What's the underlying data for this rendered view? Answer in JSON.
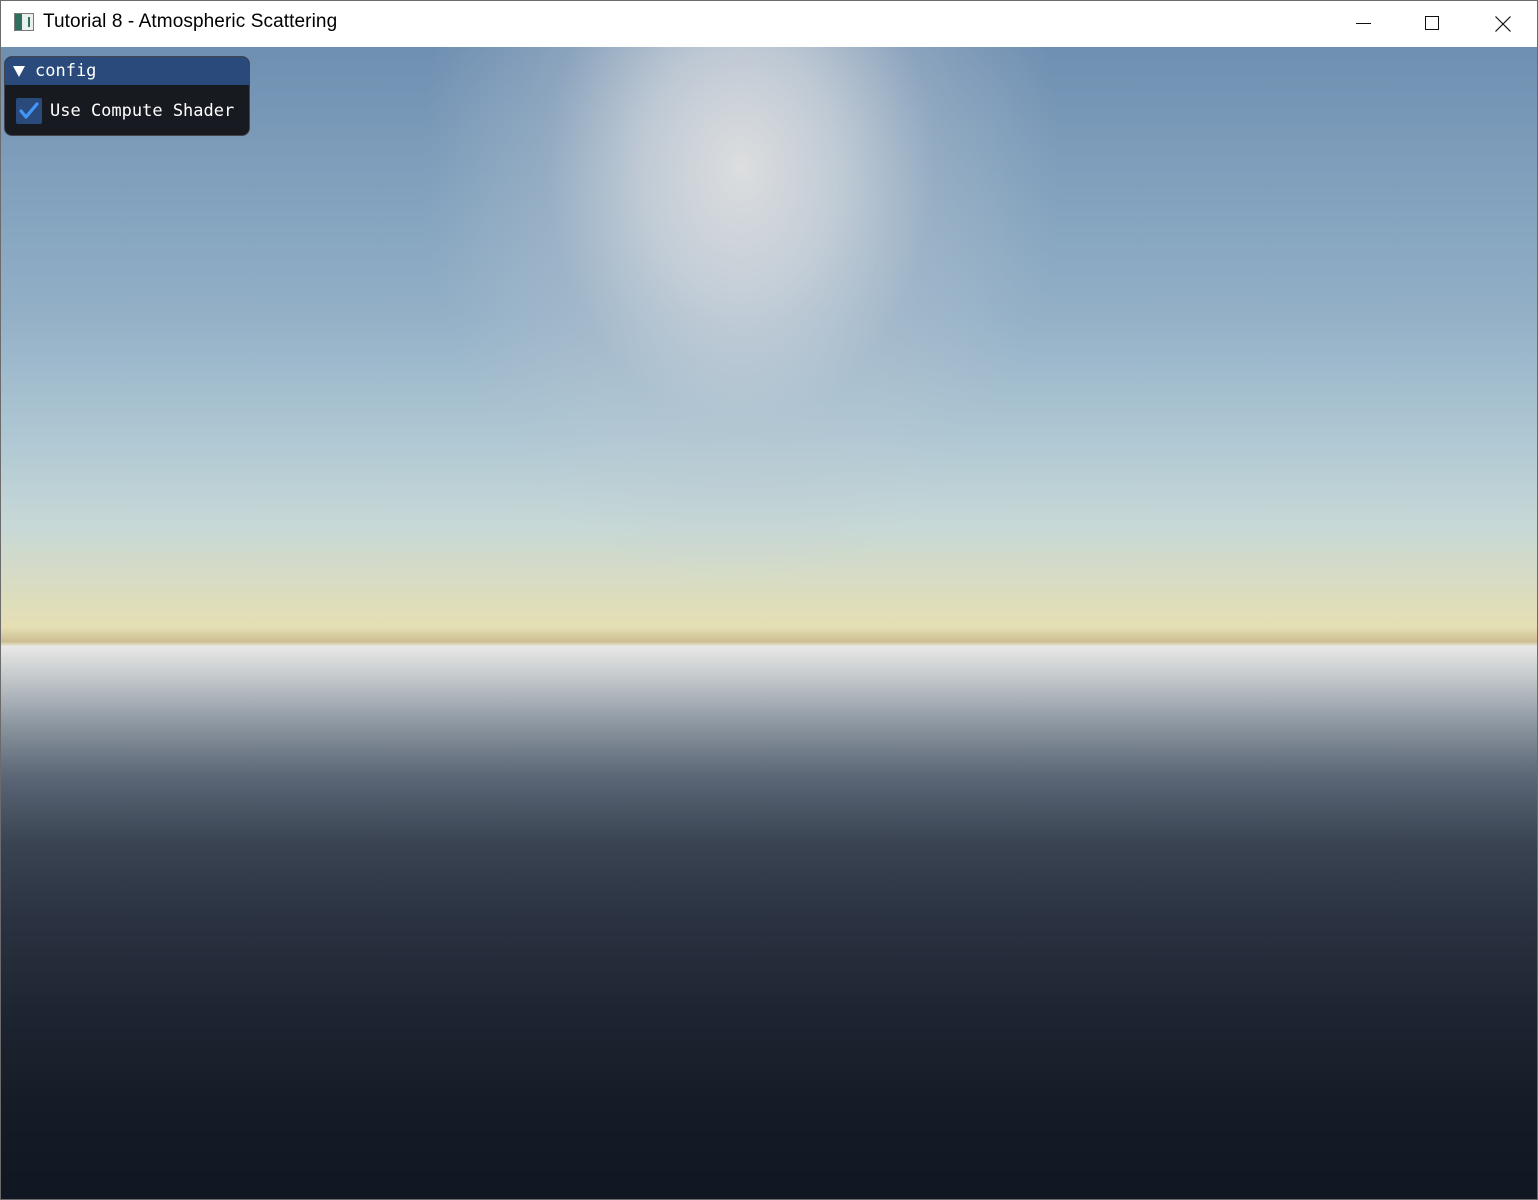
{
  "window": {
    "title": "Tutorial 8 - Atmospheric Scattering",
    "icon": "app-window-icon",
    "controls": {
      "minimize_icon": "minimize-icon",
      "maximize_icon": "maximize-icon",
      "close_icon": "close-icon"
    }
  },
  "scene": {
    "description_colors": {
      "sky_top": "#6f8fb2",
      "sun_glow": "#d7d9dc",
      "horizon": "#e6dfb4",
      "ground_near_horizon": "#e9e9e6",
      "ground_bottom": "#111722"
    }
  },
  "config_panel": {
    "title": "config",
    "collapse_icon": "triangle-down-icon",
    "title_bar_color": "#294a7a",
    "options": [
      {
        "label": "Use Compute Shader",
        "checked": true,
        "check_icon": "checkmark-icon",
        "check_color": "#4296fa"
      }
    ]
  }
}
